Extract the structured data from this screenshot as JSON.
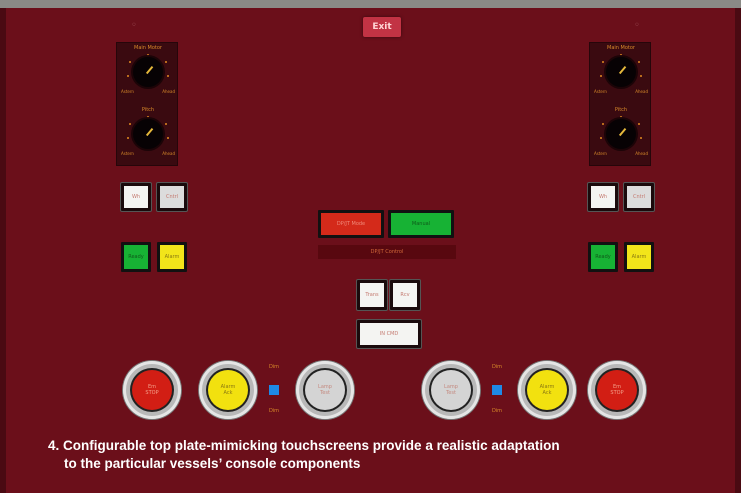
{
  "header": {
    "exit_label": "Exit"
  },
  "left_panel": {
    "knob_top_label": "Main Motor",
    "knob_bottom_label": "Pitch",
    "scale_left": "Astern",
    "scale_right": "Ahead",
    "btn_row1": [
      "Wh",
      "Cntrl"
    ],
    "btn_row2": [
      "Ready",
      "Alarm"
    ]
  },
  "right_panel": {
    "knob_top_label": "Main Motor",
    "knob_bottom_label": "Pitch",
    "scale_left": "Astern",
    "scale_right": "Ahead",
    "btn_row1": [
      "Wh",
      "Cntrl"
    ],
    "btn_row2": [
      "Ready",
      "Alarm"
    ]
  },
  "center": {
    "dp_btn_red": "DP/JT Mode",
    "dp_btn_green": "Manual",
    "dp_label": "DP/JT Control",
    "small_btn_1": "Trans",
    "small_btn_2": "Rcv",
    "wide_btn": "IN CMD"
  },
  "bottom_left": {
    "red_round": [
      "Em",
      "STOP"
    ],
    "yellow_round": [
      "Alarm",
      "Ack"
    ],
    "gray_round": [
      "Lamp",
      "Test"
    ],
    "label_top": "Dim",
    "label_bottom": "Dim"
  },
  "bottom_right": {
    "gray_round": [
      "Lamp",
      "Test"
    ],
    "yellow_round": [
      "Alarm",
      "Ack"
    ],
    "red_round": [
      "Em",
      "STOP"
    ],
    "label_top": "Dim",
    "label_bottom": "Dim"
  },
  "caption": {
    "line1": "4. Configurable top plate-mimicking touchscreens provide a realistic adaptation",
    "line2": "to the particular vessels’ console components"
  },
  "colors": {
    "background": "#6b0f1a",
    "accent_red": "#d42a1a",
    "accent_green": "#17b234",
    "accent_yellow": "#f2e51a",
    "indicator_blue": "#1e8ae6"
  }
}
